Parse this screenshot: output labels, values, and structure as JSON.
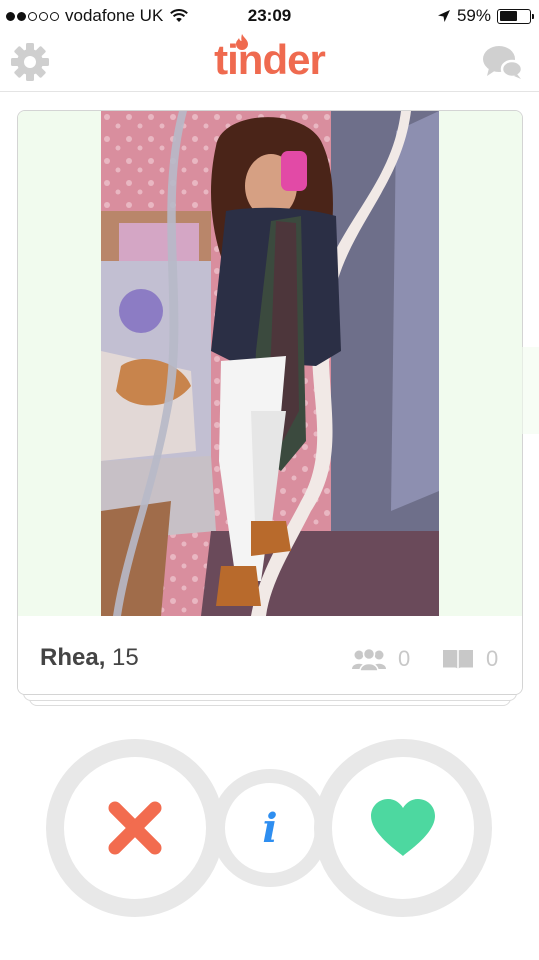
{
  "status_bar": {
    "carrier": "vodafone UK",
    "time": "23:09",
    "battery_percent_label": "59%",
    "battery_level": 0.59,
    "signal_bars_filled": 2,
    "signal_bars_total": 5
  },
  "nav": {
    "logo_text": "tinder",
    "settings_icon": "gear-icon",
    "chat_icon": "chat-bubbles-icon"
  },
  "card": {
    "name": "Rhea,",
    "age": "15",
    "shared_friends_count": "0",
    "shared_interests_count": "0",
    "friends_icon": "people-icon",
    "interests_icon": "book-icon"
  },
  "actions": {
    "nope_icon": "x-icon",
    "info_label": "i",
    "like_icon": "heart-icon"
  },
  "colors": {
    "brand": "#ef6a4f",
    "nope": "#f26c4f",
    "like": "#4dd8a0",
    "info": "#2e8ef0",
    "ring": "#e8e8e8",
    "photo_matte": "#f1fbee",
    "icon_gray": "#c8c8c8"
  }
}
